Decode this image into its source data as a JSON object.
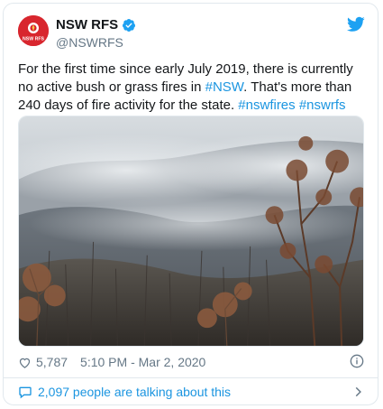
{
  "account": {
    "name": "NSW RFS",
    "handle": "@NSWRFS",
    "avatar_text": "NSW RFS",
    "verified": true
  },
  "tweet": {
    "text_parts": [
      {
        "text": "For the first time since early July 2019, there is currently no active bush or grass fires in ",
        "link": false
      },
      {
        "text": "#NSW",
        "link": true
      },
      {
        "text": ". That's more than 240 days of fire activity for the state. ",
        "link": false
      },
      {
        "text": "#nswfires",
        "link": true
      },
      {
        "text": " ",
        "link": false
      },
      {
        "text": "#nswrfs",
        "link": true
      }
    ]
  },
  "meta": {
    "likes": "5,787",
    "timestamp": "5:10 PM - Mar 2, 2020"
  },
  "conversation": {
    "label": "2,097 people are talking about this"
  },
  "icons": {
    "verified": "verified-badge-icon",
    "bird": "twitter-bird-icon",
    "heart": "heart-icon",
    "info": "info-icon",
    "bubble": "speech-bubble-icon",
    "chevron": "chevron-right-icon"
  },
  "colors": {
    "link": "#1b95e0",
    "brand_red": "#d8262e",
    "secondary_text": "#657786"
  }
}
